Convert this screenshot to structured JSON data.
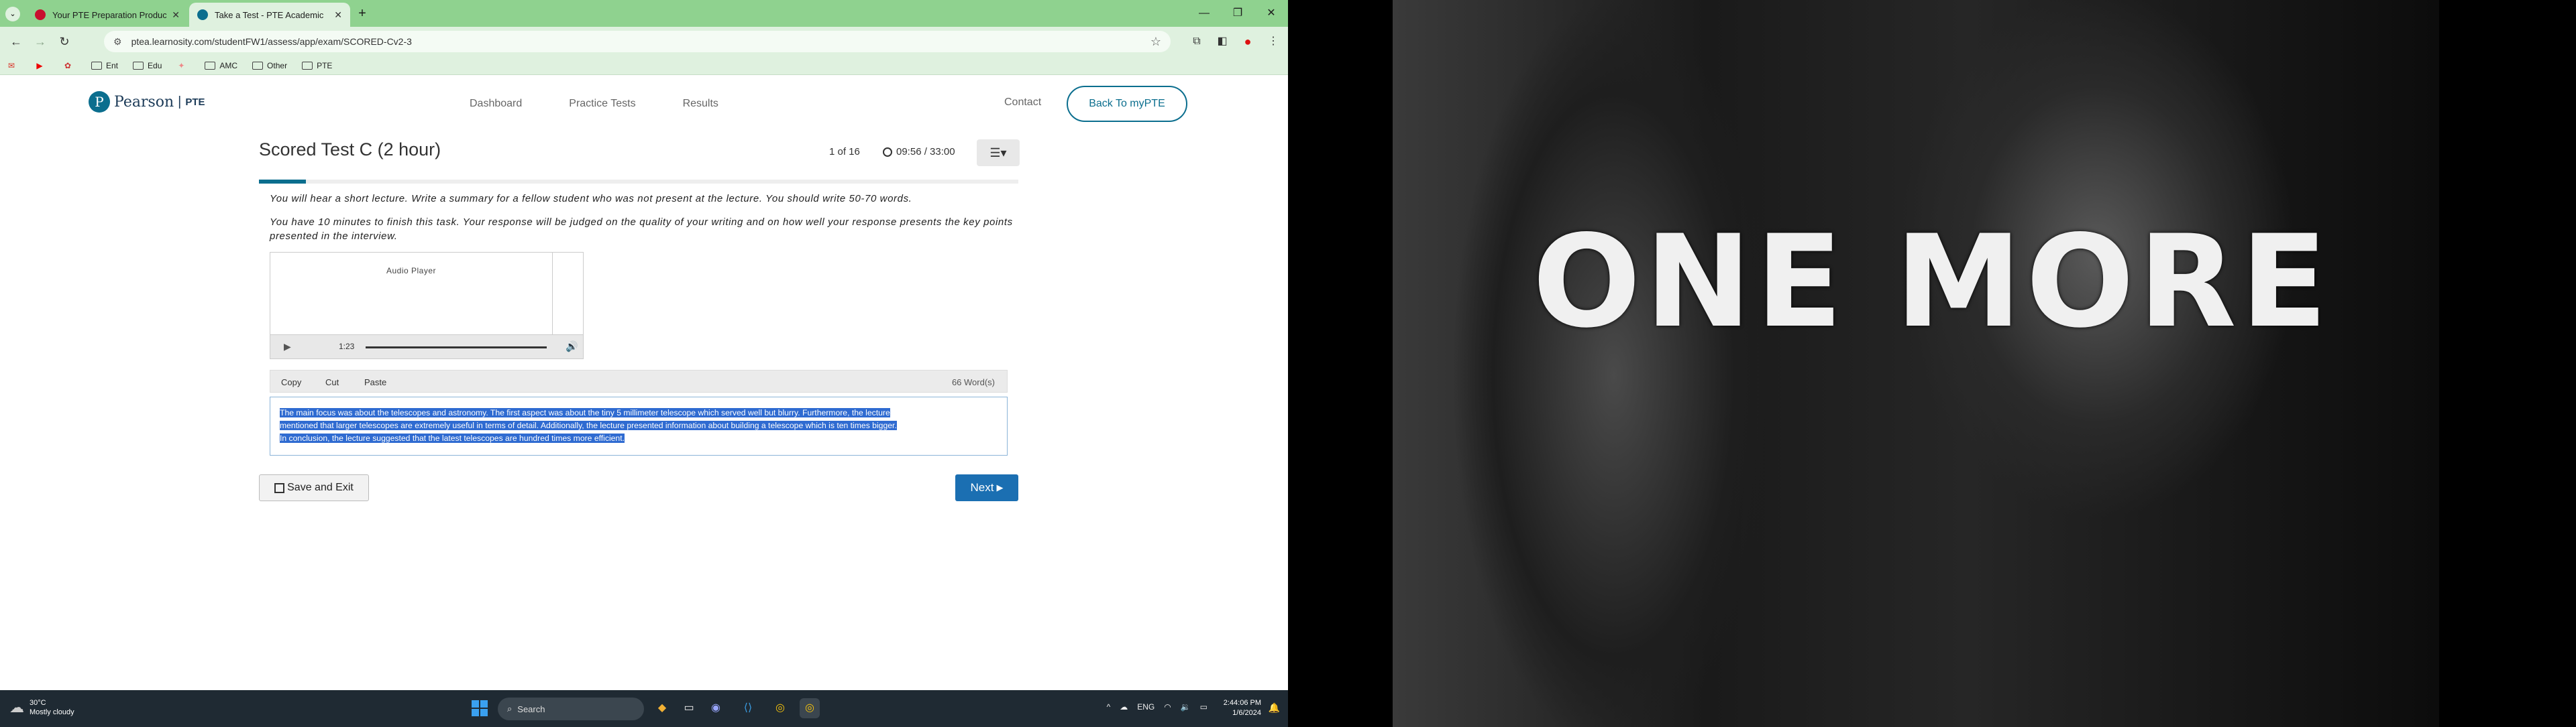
{
  "browser": {
    "tabs": [
      {
        "title": "Your PTE Preparation Product",
        "favicon_color": "#c8102e"
      },
      {
        "title": "Take a Test - PTE Academic",
        "favicon_color": "#0b6e8e"
      }
    ],
    "url": "ptea.learnosity.com/studentFW1/assess/app/exam/SCORED-Cv2-3",
    "bookmarks": [
      "Ent",
      "Edu",
      "AMC",
      "Other",
      "PTE"
    ]
  },
  "site": {
    "logo_word": "Pearson",
    "logo_suffix": "PTE",
    "nav": [
      "Dashboard",
      "Practice Tests",
      "Results"
    ],
    "contact": "Contact",
    "back_button": "Back To myPTE"
  },
  "test": {
    "title": "Scored Test C (2 hour)",
    "counter": "1 of 16",
    "timer": "09:56 / 33:00",
    "instruction_1": "You will hear a short lecture. Write a summary for a fellow student who was not present at the lecture. You should write 50-70 words.",
    "instruction_2": "You have 10 minutes to finish this task. Your response will be judged on the quality of your writing and on how well your response presents the key points presented in the interview.",
    "audio": {
      "title": "Audio Player",
      "time": "1:23"
    },
    "editor": {
      "copy": "Copy",
      "cut": "Cut",
      "paste": "Paste",
      "word_count": "66 Word(s)",
      "line_1": "The main focus was about the telescopes and astronomy. The first aspect was about the tiny 5 millimeter telescope which served well but blurry. Furthermore, the lecture",
      "line_2": "mentioned that larger telescopes are extremely useful in terms of detail. Additionally, the lecture presented information about building a telescope which is ten times bigger.",
      "line_3": "In conclusion, the lecture suggested that the latest telescopes are hundred times more efficient."
    },
    "save_exit": "Save and Exit",
    "next": "Next"
  },
  "wallpaper": {
    "text": "ONE MORE"
  },
  "taskbar": {
    "temperature": "30°C",
    "weather": "Mostly cloudy",
    "search": "Search",
    "language": "ENG",
    "time": "2:44:06 PM",
    "date": "1/6/2024"
  }
}
